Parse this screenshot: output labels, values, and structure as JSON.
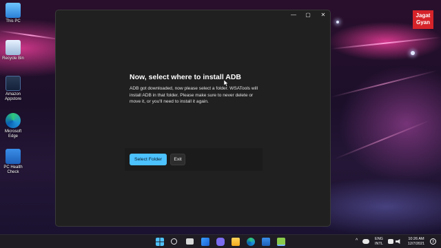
{
  "desktop": {
    "icons": [
      {
        "label": "This PC",
        "icon": "this-pc-icon"
      },
      {
        "label": "Recycle Bin",
        "icon": "recycle-bin-icon"
      },
      {
        "label": "Amazon Appstore",
        "icon": "amazon-appstore-icon"
      },
      {
        "label": "Microsoft Edge",
        "icon": "edge-icon"
      },
      {
        "label": "PC Health Check",
        "icon": "pc-health-check-icon"
      }
    ],
    "watermark": "Jagat Gyan"
  },
  "window": {
    "controls": {
      "minimize": "—",
      "maximize": "▢",
      "close": "✕"
    },
    "heading": "Now, select where to install ADB",
    "body": "ADB got downloaded, now please select a folder. WSATools will install ADB in that folder. Please make sure to never delete or move it, or you'll need to install it again.",
    "buttons": {
      "select_folder": "Select Folder",
      "exit": "Exit"
    },
    "colors": {
      "accent": "#4cc2ff",
      "background": "#202020"
    }
  },
  "taskbar": {
    "icons": [
      "windows-start-icon",
      "search-icon",
      "task-view-icon",
      "widgets-icon",
      "chat-icon",
      "file-explorer-icon",
      "edge-icon",
      "store-icon",
      "wsatools-icon"
    ],
    "tray": {
      "language_line1": "ENG",
      "language_line2": "INTL",
      "time": "10:26 AM",
      "date": "12/7/2021",
      "notification_count": "3"
    }
  }
}
